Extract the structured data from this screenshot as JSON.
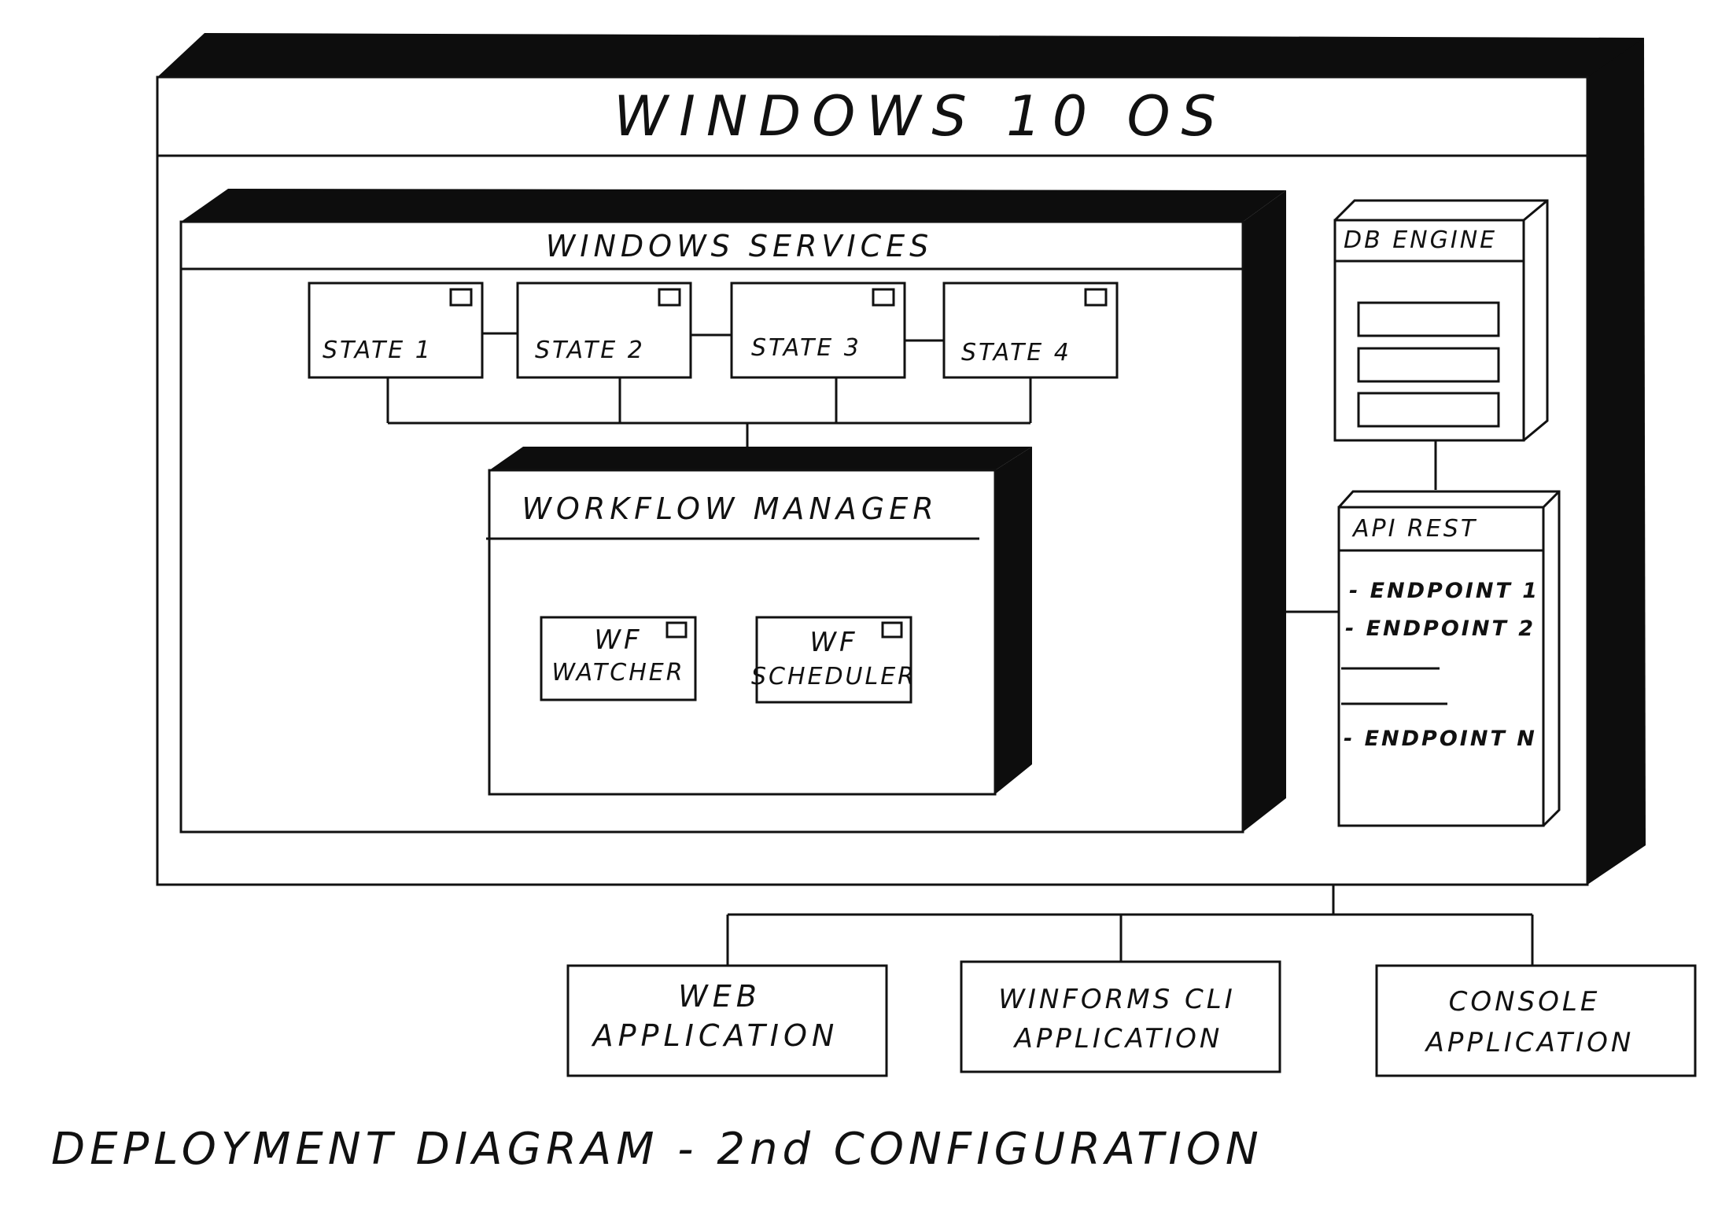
{
  "windows_os": {
    "title": "WINDOWS 10 OS"
  },
  "windows_services": {
    "title": "WINDOWS SERVICES",
    "states": [
      "STATE 1",
      "STATE 2",
      "STATE 3",
      "STATE 4"
    ]
  },
  "workflow_manager": {
    "title": "WORKFLOW MANAGER",
    "watcher": {
      "line1": "WF",
      "line2": "WATCHER"
    },
    "scheduler": {
      "line1": "WF",
      "line2": "SCHEDULER"
    }
  },
  "db_engine": {
    "title": "DB ENGINE"
  },
  "api_rest": {
    "title": "API REST",
    "endpoints": [
      "- ENDPOINT 1",
      "- ENDPOINT 2",
      "- ENDPOINT N"
    ]
  },
  "clients": {
    "web": {
      "line1": "WEB",
      "line2": "APPLICATION"
    },
    "winforms": {
      "line1": "WINFORMS CLI",
      "line2": "APPLICATION"
    },
    "console": {
      "line1": "CONSOLE",
      "line2": "APPLICATION"
    }
  },
  "caption": "DEPLOYMENT DIAGRAM - 2nd CONFIGURATION"
}
